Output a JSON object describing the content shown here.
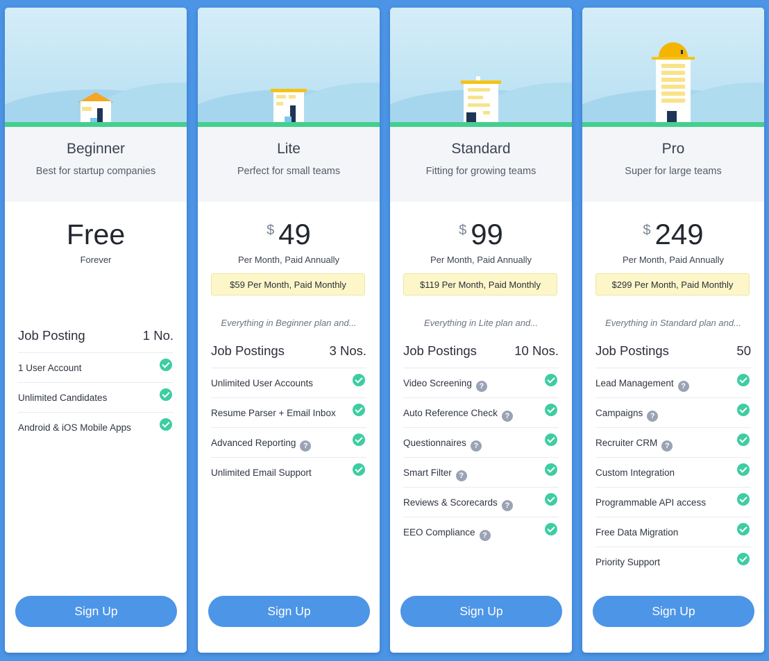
{
  "colors": {
    "background": "#4b94e6",
    "accent": "#4d95e7",
    "check": "#3ecda2",
    "highlight": "#fdf6c8"
  },
  "plans": [
    {
      "name": "Beginner",
      "description": "Best for startup companies",
      "currency": "",
      "price": "Free",
      "price_sub": "Forever",
      "monthly": "",
      "everything": "",
      "postings_label": "Job Posting",
      "postings_value": "1 No.",
      "features": [
        {
          "label": "1 User Account",
          "help": false
        },
        {
          "label": "Unlimited Candidates",
          "help": false
        },
        {
          "label": "Android & iOS Mobile Apps",
          "help": false
        }
      ],
      "cta": "Sign Up"
    },
    {
      "name": "Lite",
      "description": "Perfect for small teams",
      "currency": "$",
      "price": "49",
      "price_sub": "Per Month, Paid Annually",
      "monthly": "$59 Per Month, Paid Monthly",
      "everything": "Everything in Beginner plan and...",
      "postings_label": "Job Postings",
      "postings_value": "3 Nos.",
      "features": [
        {
          "label": "Unlimited User Accounts",
          "help": false
        },
        {
          "label": "Resume Parser + Email Inbox",
          "help": false
        },
        {
          "label": "Advanced Reporting",
          "help": true
        },
        {
          "label": "Unlimited Email Support",
          "help": false
        }
      ],
      "cta": "Sign Up"
    },
    {
      "name": "Standard",
      "description": "Fitting for growing teams",
      "currency": "$",
      "price": "99",
      "price_sub": "Per Month, Paid Annually",
      "monthly": "$119 Per Month, Paid Monthly",
      "everything": "Everything in Lite plan and...",
      "postings_label": "Job Postings",
      "postings_value": "10 Nos.",
      "features": [
        {
          "label": "Video Screening",
          "help": true
        },
        {
          "label": "Auto Reference Check",
          "help": true
        },
        {
          "label": "Questionnaires",
          "help": true
        },
        {
          "label": "Smart Filter",
          "help": true
        },
        {
          "label": "Reviews & Scorecards",
          "help": true
        },
        {
          "label": "EEO Compliance",
          "help": true
        }
      ],
      "cta": "Sign Up"
    },
    {
      "name": "Pro",
      "description": "Super for large teams",
      "currency": "$",
      "price": "249",
      "price_sub": "Per Month, Paid Annually",
      "monthly": "$299 Per Month, Paid Monthly",
      "everything": "Everything in Standard plan and...",
      "postings_label": "Job Postings",
      "postings_value": "50",
      "features": [
        {
          "label": "Lead Management",
          "help": true
        },
        {
          "label": "Campaigns",
          "help": true
        },
        {
          "label": "Recruiter CRM",
          "help": true
        },
        {
          "label": "Custom Integration",
          "help": false
        },
        {
          "label": "Programmable API access",
          "help": false
        },
        {
          "label": "Free Data Migration",
          "help": false
        },
        {
          "label": "Priority Support",
          "help": false
        }
      ],
      "cta": "Sign Up"
    }
  ]
}
